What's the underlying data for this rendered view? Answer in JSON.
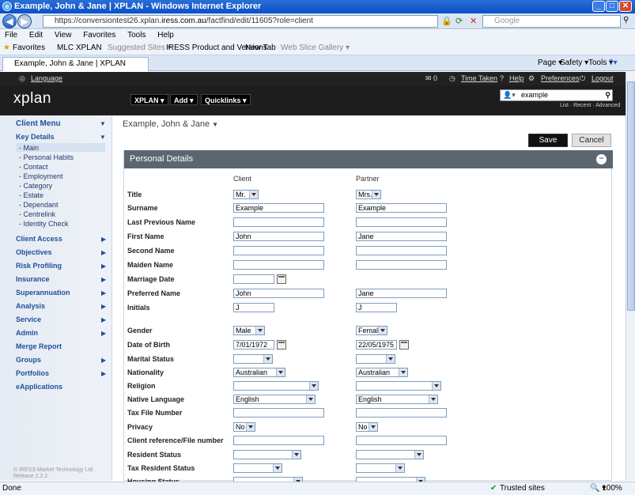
{
  "browser": {
    "title": "Example, John & Jane | XPLAN - Windows Internet Explorer",
    "url_prefix": "https://conversiontest26.xplan.",
    "url_domain": "iress.com.au",
    "url_suffix": "/factfind/edit/11605?role=client",
    "search_placeholder": "Google",
    "menu": [
      "File",
      "Edit",
      "View",
      "Favorites",
      "Tools",
      "Help"
    ],
    "favorites_label": "Favorites",
    "favorites": [
      "MLC XPLAN",
      "Suggested Sites ▾",
      "IRESS Product and Versions",
      "New Tab",
      "Web Slice Gallery ▾"
    ],
    "tab_title": "Example, John & Jane | XPLAN",
    "commands": [
      "Page ▾",
      "Safety ▾",
      "Tools ▾"
    ],
    "status_text": "Done",
    "zone": "Trusted sites",
    "zoom": "100%"
  },
  "app": {
    "language": "Language",
    "top_links": [
      "Time Taken",
      "Help",
      "Preferences",
      "Logout"
    ],
    "logo": "xplan",
    "nav": [
      "XPLAN",
      "Add",
      "Quicklinks"
    ],
    "search_value": "example",
    "search_links": "List · Recent · Advanced"
  },
  "sidebar": {
    "client_menu": "Client Menu",
    "key_details": "Key Details",
    "sub_items": [
      "- Main",
      "- Personal Habits",
      "- Contact",
      "- Employment",
      "- Category",
      "- Estate",
      "- Dependant",
      "- Centrelink",
      "- Identity Check"
    ],
    "sections": [
      "Client Access",
      "Objectives",
      "Risk Profiling",
      "Insurance",
      "Superannuation",
      "Analysis",
      "Service",
      "Admin",
      "Merge Report",
      "Groups",
      "Portfolios",
      "eApplications"
    ],
    "release": "© IRESS Market Technology Ltd\nRelease 2.2.2"
  },
  "page": {
    "client_name": "Example, John & Jane",
    "save": "Save",
    "cancel": "Cancel",
    "panel_title": "Personal Details",
    "col_client": "Client",
    "col_partner": "Partner"
  },
  "fields": [
    {
      "label": "Title",
      "type": "select",
      "client": "Mr.",
      "partner": "Mrs."
    },
    {
      "label": "Surname",
      "type": "text",
      "client": "Example",
      "partner": "Example"
    },
    {
      "label": "Last Previous Name",
      "type": "text",
      "client": "",
      "partner": ""
    },
    {
      "label": "First Name",
      "type": "text",
      "client": "John",
      "partner": "Jane"
    },
    {
      "label": "Second Name",
      "type": "text",
      "client": "",
      "partner": ""
    },
    {
      "label": "Maiden Name",
      "type": "text",
      "client": "",
      "partner": ""
    },
    {
      "label": "Marriage Date",
      "type": "date",
      "client": "",
      "partner": null
    },
    {
      "label": "Preferred Name",
      "type": "text",
      "client": "John",
      "partner": "Jane"
    },
    {
      "label": "Initials",
      "type": "short",
      "client": "J",
      "partner": "J"
    },
    {
      "label": "Gender",
      "type": "select",
      "client": "Male",
      "partner": "Female"
    },
    {
      "label": "Date of Birth",
      "type": "date",
      "client": "7/01/1972",
      "partner": "22/05/1975"
    },
    {
      "label": "Marital Status",
      "type": "select",
      "client": "",
      "partner": ""
    },
    {
      "label": "Nationality",
      "type": "select",
      "client": "Australian",
      "partner": "Australian"
    },
    {
      "label": "Religion",
      "type": "select",
      "client": "",
      "partner": ""
    },
    {
      "label": "Native Language",
      "type": "select",
      "client": "English",
      "partner": "English"
    },
    {
      "label": "Tax File Number",
      "type": "text",
      "client": "",
      "partner": ""
    },
    {
      "label": "Privacy",
      "type": "select",
      "client": "No",
      "partner": "No"
    },
    {
      "label": "Client reference/File number",
      "type": "text",
      "client": "",
      "partner": ""
    },
    {
      "label": "Resident Status",
      "type": "select",
      "client": "",
      "partner": ""
    },
    {
      "label": "Tax Resident Status",
      "type": "select",
      "client": "",
      "partner": ""
    },
    {
      "label": "Housing Status",
      "type": "select",
      "client": "",
      "partner": ""
    }
  ]
}
